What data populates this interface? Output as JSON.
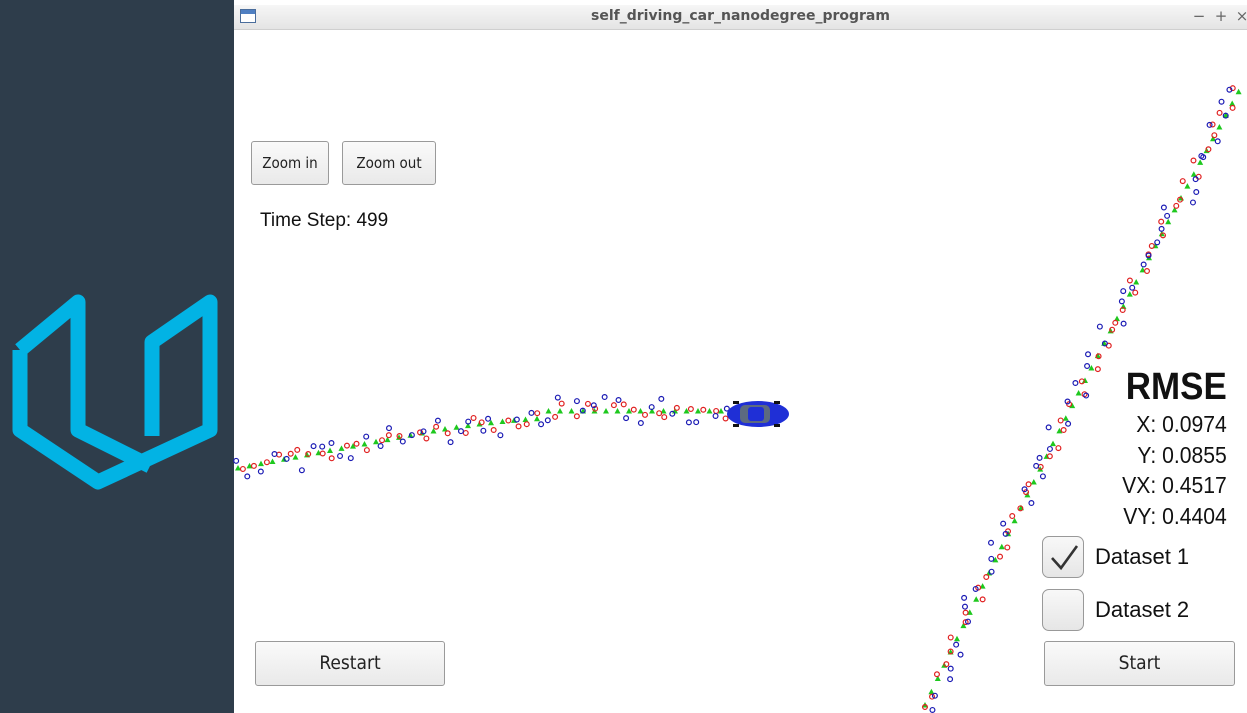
{
  "window": {
    "title": "self_driving_car_nanodegree_program",
    "controls": {
      "minimize": "−",
      "maximize": "+",
      "close": "×"
    }
  },
  "toolbar": {
    "zoom_in_label": "Zoom in",
    "zoom_out_label": "Zoom out"
  },
  "time_step": {
    "text": "Time Step: 499",
    "value": 499
  },
  "rmse": {
    "title": "RMSE",
    "x": "X: 0.0974",
    "y": "Y: 0.0855",
    "vx": "VX: 0.4517",
    "vy": "VY: 0.4404"
  },
  "datasets": [
    {
      "label": "Dataset 1",
      "checked": true
    },
    {
      "label": "Dataset 2",
      "checked": false
    }
  ],
  "buttons": {
    "restart_label": "Restart",
    "start_label": "Start"
  },
  "colors": {
    "sidebar": "#2e3d4b",
    "logo": "#02b3e4",
    "lidar_marker": "#e02020",
    "radar_marker": "#1a1ab4",
    "estimate_marker": "#1ec81e",
    "car": "#1f2fd6"
  },
  "icons": {
    "window_icon": "window-icon",
    "logo": "udacity-logo",
    "car": "car-icon",
    "check": "checkmark-icon"
  }
}
